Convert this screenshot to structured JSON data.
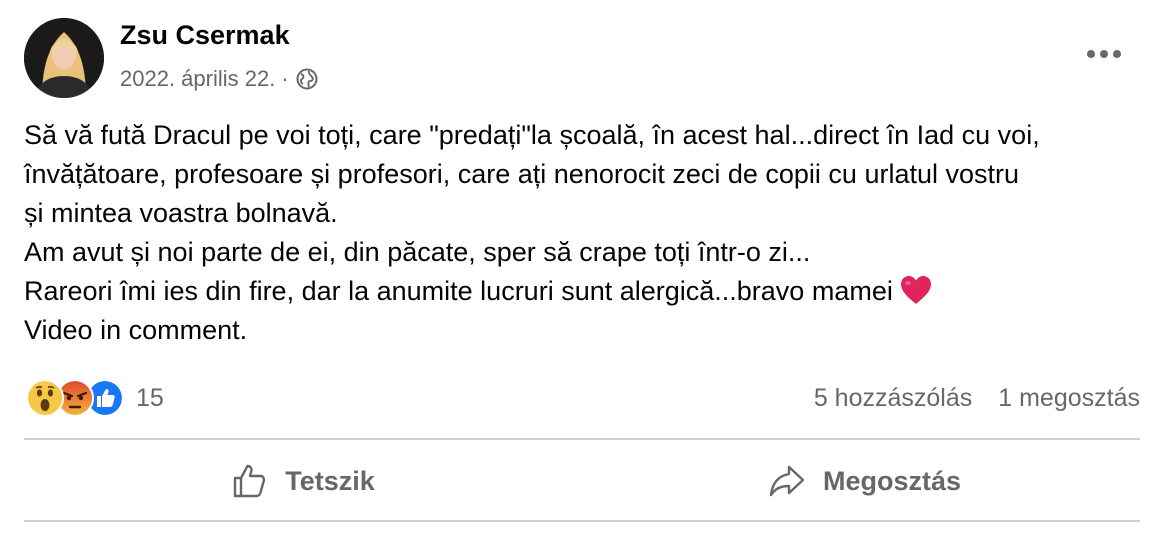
{
  "post": {
    "author": "Zsu Csermak",
    "date": "2022. április 22.",
    "separator": "·",
    "text_lines": [
      "Să vă fută Dracul pe voi toți, care \"predați\"la școală, în acest hal...direct în Iad cu voi,",
      "învățătoare, profesoare și profesori, care ați nenorocit zeci de copii cu urlatul vostru",
      "și mintea voastra bolnavă.",
      "Am avut și noi parte de ei, din păcate, sper să crape toți într-o zi...",
      "Rareori îmi ies din fire, dar la anumite lucruri sunt alergică...bravo mamei",
      "Video in comment."
    ]
  },
  "reactions": {
    "icons": [
      "wow-reaction-icon",
      "angry-reaction-icon",
      "like-reaction-icon"
    ],
    "count": "15"
  },
  "stats": {
    "comments": "5 hozzászólás",
    "shares": "1 megosztás"
  },
  "actions": {
    "like_label": "Tetszik",
    "share_label": "Megosztás"
  },
  "colors": {
    "text": "#050505",
    "secondary": "#65676b",
    "divider": "#ced0d4",
    "like_blue": "#1877f2",
    "angry_red": "#e9710f",
    "heart_red": "#e0245e"
  }
}
